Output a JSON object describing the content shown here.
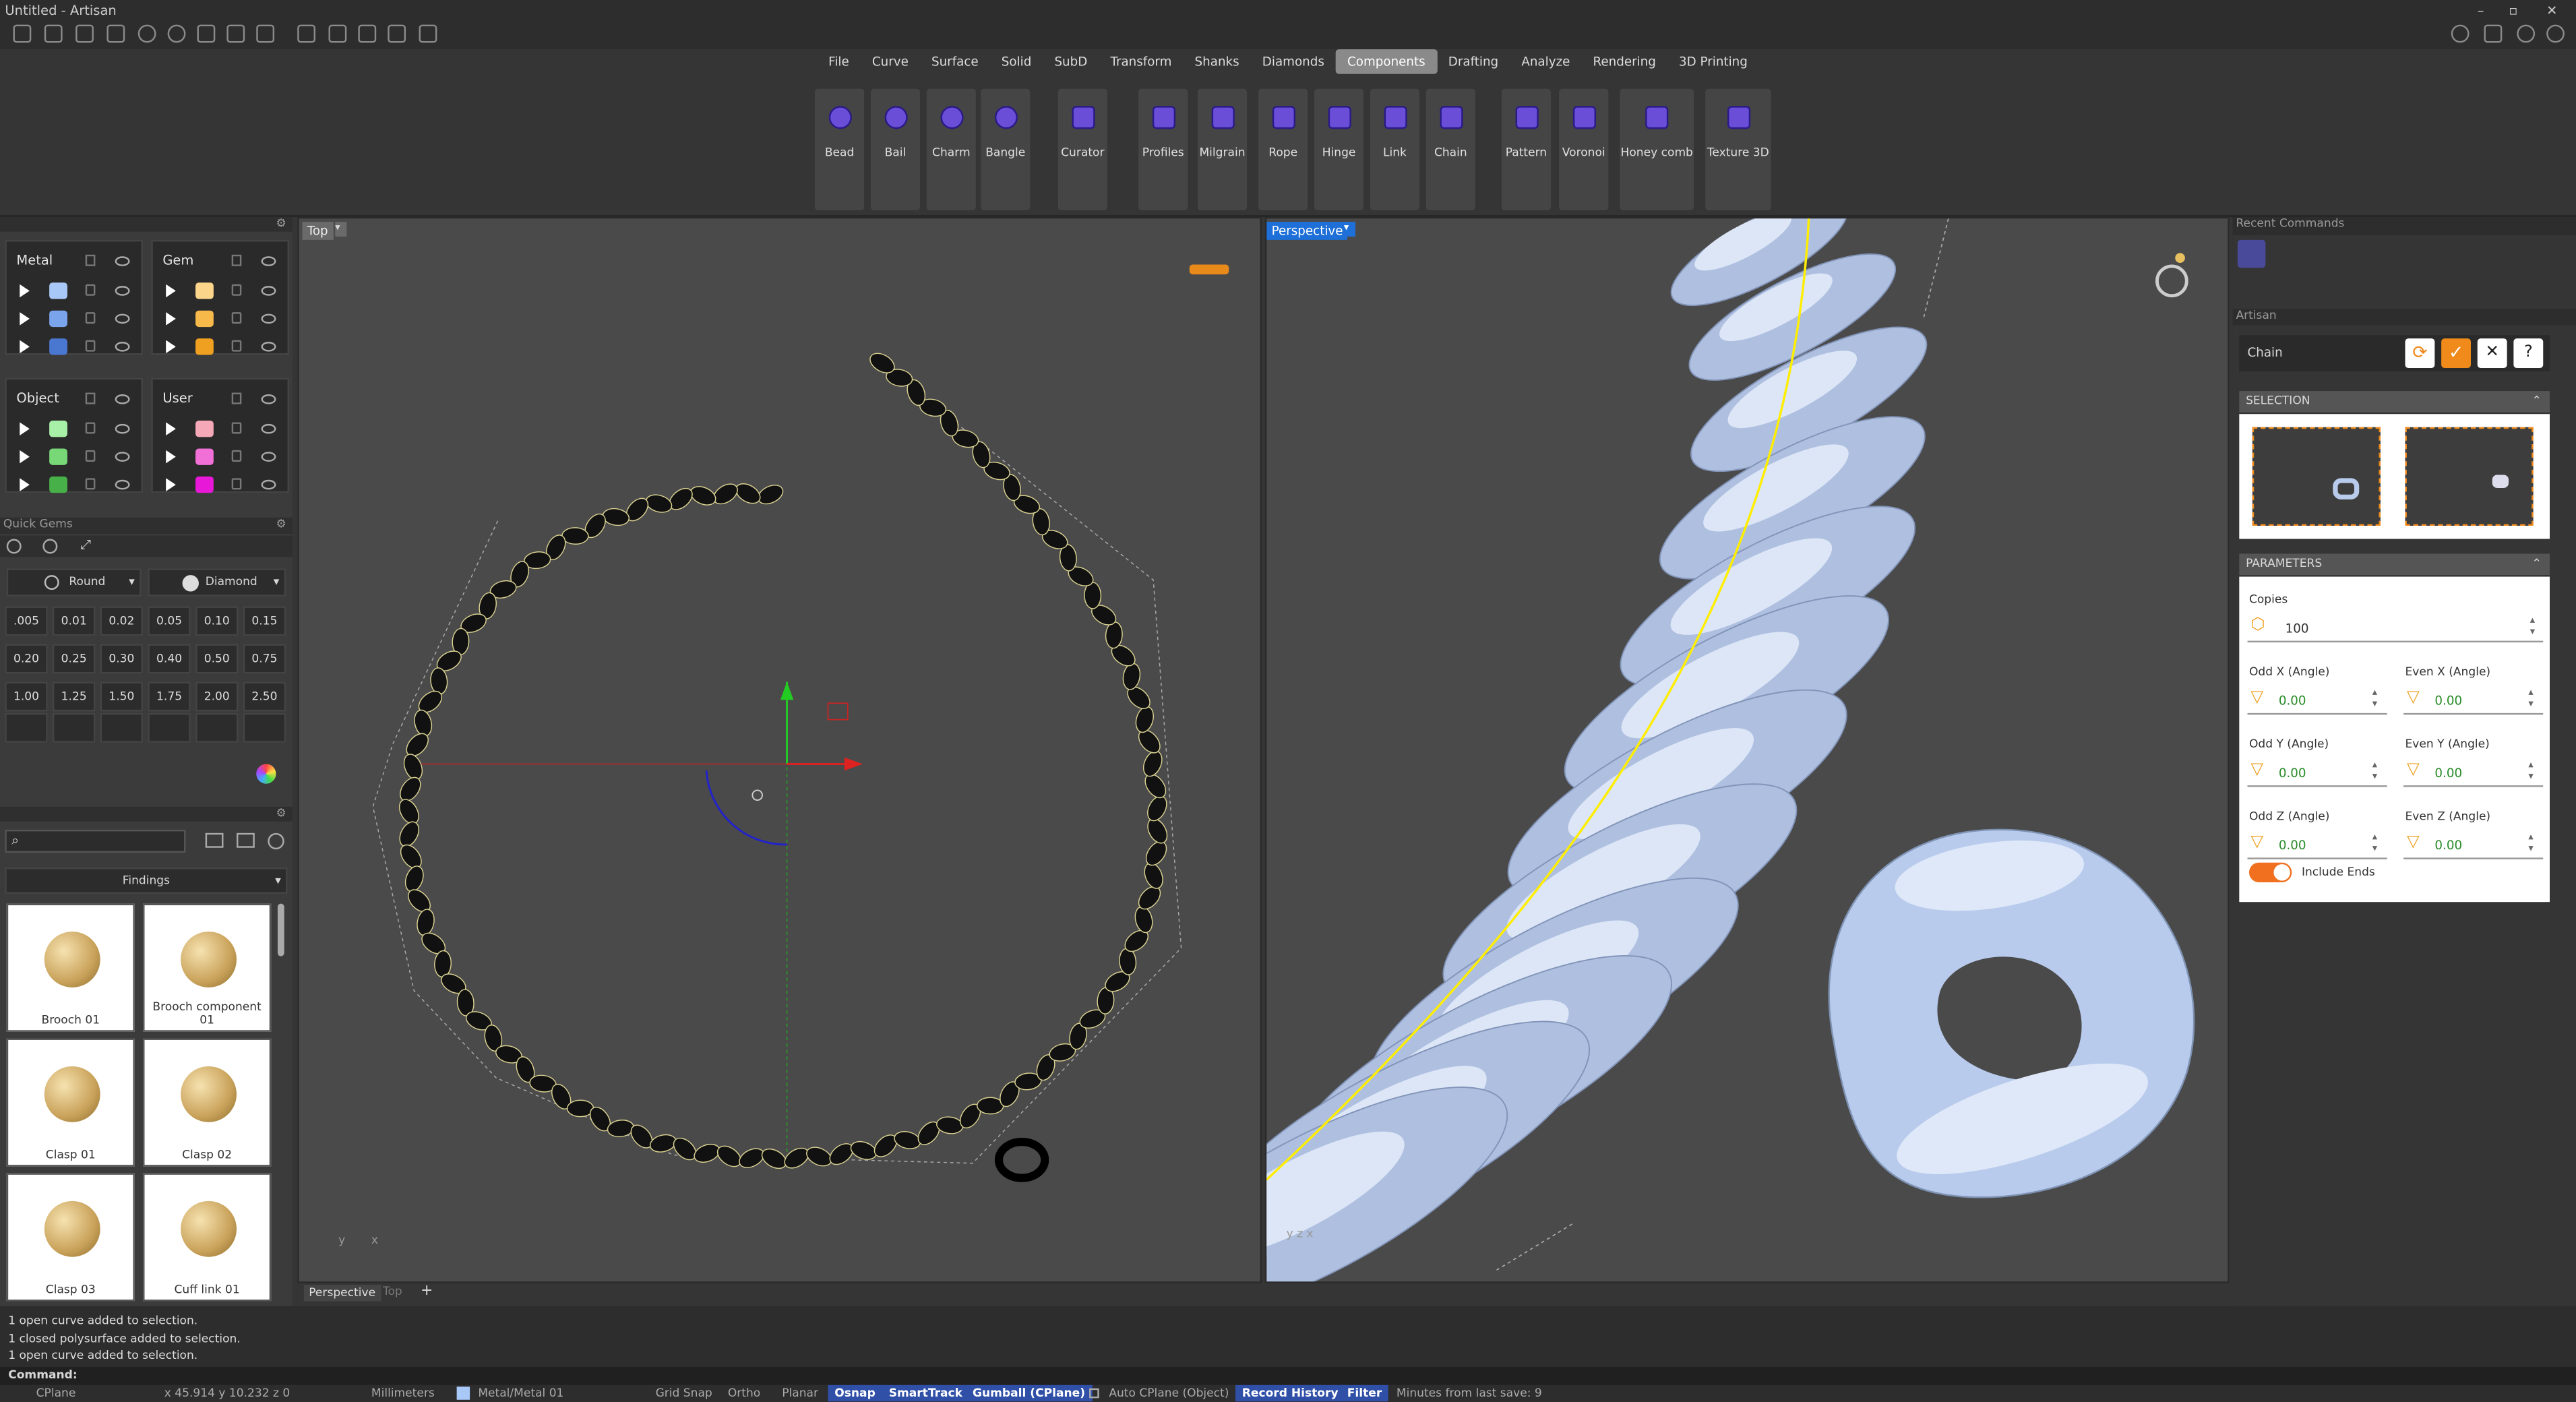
{
  "app": {
    "title": "Untitled - Artisan"
  },
  "ribbon_tabs": [
    "File",
    "Curve",
    "Surface",
    "Solid",
    "SubD",
    "Transform",
    "Shanks",
    "Diamonds",
    "Components",
    "Drafting",
    "Analyze",
    "Rendering",
    "3D Printing"
  ],
  "active_tab": "Components",
  "ribbon_buttons": [
    {
      "label": "Bead",
      "icon": "bead-icon"
    },
    {
      "label": "Bail",
      "icon": "bail-icon"
    },
    {
      "label": "Charm",
      "icon": "charm-icon"
    },
    {
      "label": "Bangle",
      "icon": "bangle-icon"
    },
    {
      "label": "Curator",
      "icon": "curator-icon"
    },
    {
      "label": "Profiles",
      "icon": "profiles-icon"
    },
    {
      "label": "Milgrain",
      "icon": "milgrain-icon"
    },
    {
      "label": "Rope",
      "icon": "rope-icon"
    },
    {
      "label": "Hinge",
      "icon": "hinge-icon"
    },
    {
      "label": "Link",
      "icon": "link-icon"
    },
    {
      "label": "Chain",
      "icon": "chain-icon"
    },
    {
      "label": "Pattern",
      "icon": "pattern-icon"
    },
    {
      "label": "Voronoi",
      "icon": "voronoi-icon"
    },
    {
      "label": "Honey comb",
      "icon": "honeycomb-icon"
    },
    {
      "label": "Texture 3D",
      "icon": "texture-icon"
    }
  ],
  "layers": {
    "metal": {
      "title": "Metal",
      "colors": [
        "#a8c8f8",
        "#7aa4ec",
        "#4a78d0"
      ]
    },
    "gem": {
      "title": "Gem",
      "colors": [
        "#fad58a",
        "#f7b94a",
        "#f0a020"
      ]
    },
    "object": {
      "title": "Object",
      "colors": [
        "#a8f0a8",
        "#78d878",
        "#48b048"
      ]
    },
    "user": {
      "title": "User",
      "colors": [
        "#f5a8b8",
        "#f070d8",
        "#e818d8"
      ]
    }
  },
  "quick_gems": {
    "title": "Quick Gems",
    "shape": "Round",
    "material": "Diamond",
    "sizes": [
      ".005",
      "0.01",
      "0.02",
      "0.05",
      "0.10",
      "0.15",
      "0.20",
      "0.25",
      "0.30",
      "0.40",
      "0.50",
      "0.75",
      "1.00",
      "1.25",
      "1.50",
      "1.75",
      "2.00",
      "2.50"
    ]
  },
  "library": {
    "category": "Findings",
    "items": [
      "Brooch 01",
      "Brooch component 01",
      "Clasp 01",
      "Clasp 02",
      "Clasp 03",
      "Cuff link 01"
    ]
  },
  "viewports": {
    "top": "Top",
    "perspective": "Perspective"
  },
  "bottom_tabs": [
    "Perspective",
    "Top"
  ],
  "right": {
    "recent_commands": "Recent Commands",
    "artisan": "Artisan",
    "command": "Chain",
    "selection": "SELECTION",
    "parameters": "PARAMETERS",
    "copies_label": "Copies",
    "copies_value": "100",
    "params": [
      {
        "label": "Odd X (Angle)",
        "value": "0.00"
      },
      {
        "label": "Even X (Angle)",
        "value": "0.00"
      },
      {
        "label": "Odd Y (Angle)",
        "value": "0.00"
      },
      {
        "label": "Even Y (Angle)",
        "value": "0.00"
      },
      {
        "label": "Odd Z (Angle)",
        "value": "0.00"
      },
      {
        "label": "Even Z (Angle)",
        "value": "0.00"
      }
    ],
    "include_ends": "Include Ends"
  },
  "history": [
    "1 open curve added to selection.",
    "1 closed polysurface added to selection.",
    "1 open curve added to selection."
  ],
  "command_label": "Command:",
  "status": {
    "cplane": "CPlane",
    "coords": "x 45.914  y 10.232  z 0",
    "units": "Millimeters",
    "layer": "Metal/Metal 01",
    "grid_snap": "Grid Snap",
    "ortho": "Ortho",
    "planar": "Planar",
    "osnap": "Osnap",
    "smarttrack": "SmartTrack",
    "gumball": "Gumball (CPlane)",
    "auto_cplane": "Auto CPlane (Object)",
    "record_history": "Record History",
    "filter": "Filter",
    "minutes": "Minutes from last save: 9"
  },
  "colors": {
    "accent": "#f08a1a",
    "tab_active": "#8a8a8a",
    "panel": "#3b3b3b",
    "viewport": "#4a4a4a",
    "status_blue": "#3050a8"
  }
}
